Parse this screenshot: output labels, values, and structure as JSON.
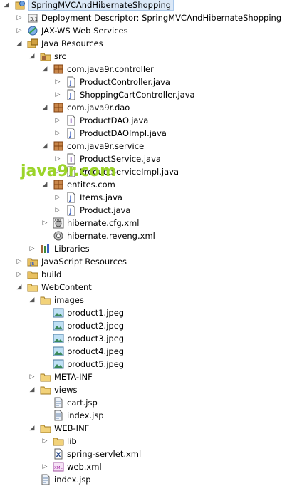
{
  "tree": {
    "items": [
      {
        "label": "SpringMVCAndHibernateShopping",
        "expanded": true,
        "icon": "web-project-icon"
      },
      {
        "label": "Deployment Descriptor: SpringMVCAndHibernateShopping",
        "expanded": false,
        "icon": "deployment-descriptor-icon"
      },
      {
        "label": "JAX-WS Web Services",
        "expanded": false,
        "icon": "jaxws-icon"
      },
      {
        "label": "Java Resources",
        "expanded": true,
        "icon": "java-resources-icon"
      },
      {
        "label": "src",
        "expanded": true,
        "icon": "source-folder-icon"
      },
      {
        "label": "com.java9r.controller",
        "expanded": true,
        "icon": "package-icon"
      },
      {
        "label": "ProductController.java",
        "expanded": false,
        "icon": "java-file-icon"
      },
      {
        "label": "ShoppingCartController.java",
        "expanded": false,
        "icon": "java-file-icon"
      },
      {
        "label": "com.java9r.dao",
        "expanded": true,
        "icon": "package-icon"
      },
      {
        "label": "ProductDAO.java",
        "expanded": false,
        "icon": "java-interface-file-icon"
      },
      {
        "label": "ProductDAOImpl.java",
        "expanded": false,
        "icon": "java-file-icon"
      },
      {
        "label": "com.java9r.service",
        "expanded": true,
        "icon": "package-icon"
      },
      {
        "label": "ProductService.java",
        "expanded": false,
        "icon": "java-interface-file-icon"
      },
      {
        "label": "ProductServiceImpl.java",
        "expanded": false,
        "icon": "java-file-icon"
      },
      {
        "label": "entites.com",
        "expanded": true,
        "icon": "package-icon"
      },
      {
        "label": "Items.java",
        "expanded": false,
        "icon": "java-file-icon"
      },
      {
        "label": "Product.java",
        "expanded": false,
        "icon": "java-file-icon"
      },
      {
        "label": "hibernate.cfg.xml",
        "expanded": false,
        "icon": "hibernate-cfg-icon"
      },
      {
        "label": "hibernate.reveng.xml",
        "expanded": false,
        "icon": "hibernate-reveng-icon"
      },
      {
        "label": "Libraries",
        "expanded": false,
        "icon": "libraries-icon"
      },
      {
        "label": "JavaScript Resources",
        "expanded": false,
        "icon": "javascript-resources-icon"
      },
      {
        "label": "build",
        "expanded": false,
        "icon": "folder-icon"
      },
      {
        "label": "WebContent",
        "expanded": true,
        "icon": "folder-icon"
      },
      {
        "label": "images",
        "expanded": true,
        "icon": "folder-icon"
      },
      {
        "label": "product1.jpeg",
        "expanded": false,
        "icon": "image-file-icon"
      },
      {
        "label": "product2.jpeg",
        "expanded": false,
        "icon": "image-file-icon"
      },
      {
        "label": "product3.jpeg",
        "expanded": false,
        "icon": "image-file-icon"
      },
      {
        "label": "product4.jpeg",
        "expanded": false,
        "icon": "image-file-icon"
      },
      {
        "label": "product5.jpeg",
        "expanded": false,
        "icon": "image-file-icon"
      },
      {
        "label": "META-INF",
        "expanded": false,
        "icon": "folder-icon"
      },
      {
        "label": "views",
        "expanded": true,
        "icon": "folder-icon"
      },
      {
        "label": "cart.jsp",
        "expanded": false,
        "icon": "jsp-file-icon"
      },
      {
        "label": "index.jsp",
        "expanded": false,
        "icon": "jsp-file-icon"
      },
      {
        "label": "WEB-INF",
        "expanded": true,
        "icon": "folder-icon"
      },
      {
        "label": "lib",
        "expanded": false,
        "icon": "folder-icon"
      },
      {
        "label": "spring-servlet.xml",
        "expanded": false,
        "icon": "xml-file-icon"
      },
      {
        "label": "web.xml",
        "expanded": false,
        "icon": "web-xml-icon"
      },
      {
        "label": "index.jsp",
        "expanded": false,
        "icon": "jsp-file-icon"
      }
    ]
  },
  "watermark": {
    "text": "java9r.com",
    "color": "#9bd42a"
  },
  "colors": {
    "selection": "#dbe8f7",
    "folder": "#e8c060",
    "package": "#a0663a",
    "java": "#3a5fc0"
  }
}
